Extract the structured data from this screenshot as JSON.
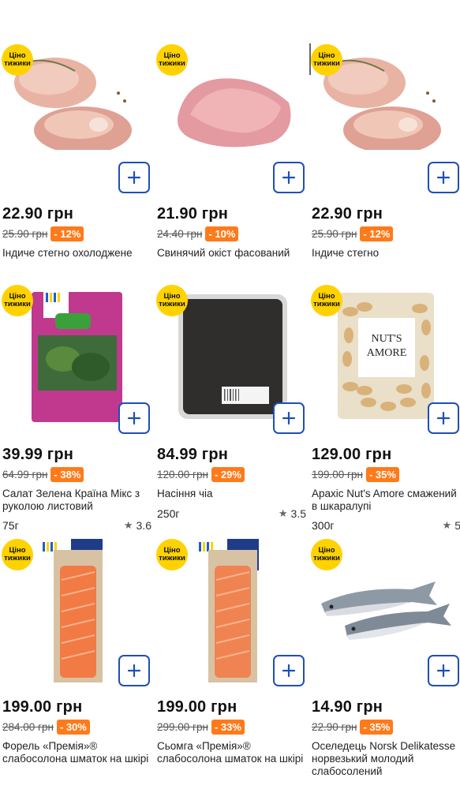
{
  "badge_text": [
    "Ціно",
    "тижики"
  ],
  "products": [
    {
      "image_icon": "turkey-thigh-image",
      "price": "22.90 грн",
      "old_price": "25.90 грн",
      "discount": "- 12%",
      "title": "Індиче стегно охолоджене",
      "weight": "",
      "rating": ""
    },
    {
      "image_icon": "pork-ham-image",
      "price": "21.90 грн",
      "old_price": "24.40 грн",
      "discount": "- 10%",
      "title": "Свинячий окіст фасований",
      "weight": "",
      "rating": ""
    },
    {
      "image_icon": "turkey-thigh-image",
      "price": "22.90 грн",
      "old_price": "25.90 грн",
      "discount": "- 12%",
      "title": "Індиче стегно",
      "weight": "",
      "rating": ""
    },
    {
      "image_icon": "salad-bag-image",
      "price": "39.99 грн",
      "old_price": "64.99 грн",
      "discount": "- 38%",
      "title": "Салат Зелена Країна Мікс з руколою листовий",
      "weight": "75г",
      "rating": "3.6"
    },
    {
      "image_icon": "chia-seeds-image",
      "price": "84.99 грн",
      "old_price": "120.00 грн",
      "discount": "- 29%",
      "title": "Насіння чіа",
      "weight": "250г",
      "rating": "3.5"
    },
    {
      "image_icon": "peanuts-bag-image",
      "price": "129.00 грн",
      "old_price": "199.00 грн",
      "discount": "- 35%",
      "title": "Арахіс Nut's Amore смажений в шкаралупі",
      "weight": "300г",
      "rating": "5"
    },
    {
      "image_icon": "trout-fillet-image",
      "price": "199.00 грн",
      "old_price": "284.00 грн",
      "discount": "- 30%",
      "title": "Форель «Премія»® слабосолона шматок на шкірі",
      "weight": "",
      "rating": ""
    },
    {
      "image_icon": "salmon-fillet-image",
      "price": "199.00 грн",
      "old_price": "299.00 грн",
      "discount": "- 33%",
      "title": "Сьомга «Премія»® слабосолона шматок на шкірі",
      "weight": "",
      "rating": ""
    },
    {
      "image_icon": "herring-image",
      "price": "14.90 грн",
      "old_price": "22.90 грн",
      "discount": "- 35%",
      "title": "Оселедець Norsk Delikatesse норвезький молодий слабосолений",
      "weight": "",
      "rating": ""
    }
  ],
  "colors": {
    "badge": "#ffd200",
    "discount": "#ff7a1a",
    "add_button_border": "#1f4fb8"
  }
}
